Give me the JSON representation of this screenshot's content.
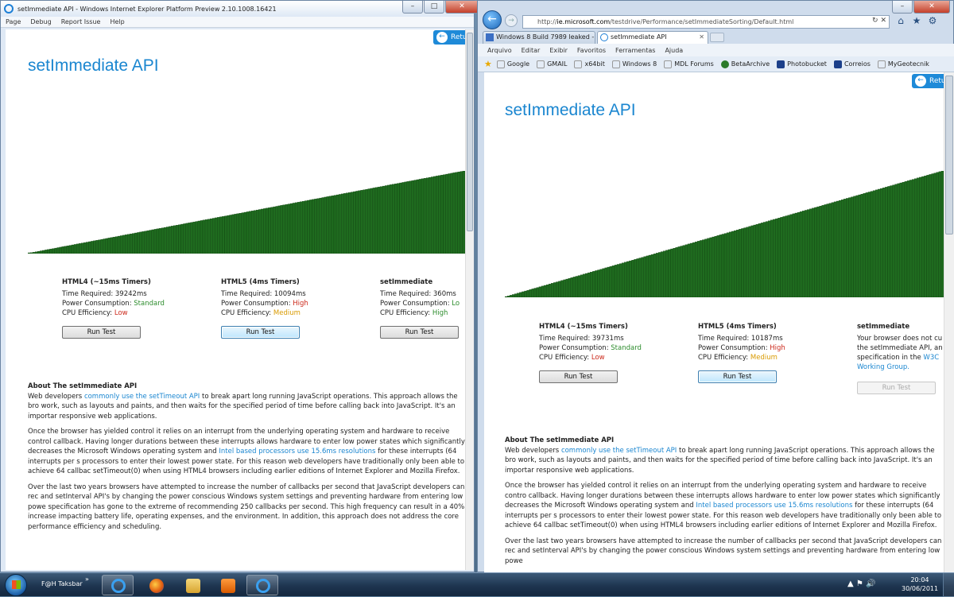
{
  "left_window": {
    "title": "setImmediate API - Windows Internet Explorer Platform Preview 2.10.1008.16421",
    "menu": [
      "Page",
      "Debug",
      "Report Issue",
      "Help"
    ],
    "return_label": "Retu",
    "page_title": "setImmediate API",
    "tests": [
      {
        "heading": "HTML4 (~15ms Timers)",
        "time": "Time Required: 39242ms",
        "power_label": "Power Consumption:",
        "power": "Standard",
        "cpu_label": "CPU Efficiency:",
        "cpu": "Low",
        "button": "Run Test"
      },
      {
        "heading": "HTML5 (4ms Timers)",
        "time": "Time Required: 10094ms",
        "power_label": "Power Consumption:",
        "power": "High",
        "cpu_label": "CPU Efficiency:",
        "cpu": "Medium",
        "button": "Run Test"
      },
      {
        "heading": "setImmediate",
        "time": "Time Required: 360ms",
        "power_label": "Power Consumption:",
        "power": "Lo",
        "cpu_label": "CPU Efficiency:",
        "cpu": "High",
        "button": "Run Test"
      }
    ],
    "about": {
      "heading": "About The setImmediate API",
      "p1_a": "Web developers ",
      "p1_link": "commonly use the setTimeout API",
      "p1_b": " to break apart long running JavaScript operations. This approach allows the bro work, such as layouts and paints, and then waits for the specified period of time before calling back into JavaScript. It's an importar responsive web applications.",
      "p2_a": "Once the browser has yielded control it relies on an interrupt from the underlying operating system and hardware to receive control callback. Having longer durations between these interrupts allows hardware to enter low power states which significantly decreases the Microsoft Windows operating system and ",
      "p2_link": "Intel based processors use 15.6ms resolutions",
      "p2_b": " for these interrupts (64 interrupts per s processors to enter their lowest power state. For this reason web developers have traditionally only been able to achieve 64 callbac setTimeout(0) when using HTML4 browsers including earlier editions of Internet Explorer and Mozilla Firefox.",
      "p3": "Over the last two years browsers have attempted to increase the number of callbacks per second that JavaScript developers can rec and setInterval API's by changing the power conscious Windows system settings and preventing hardware from entering low powe specification has gone to the extreme of recommending 250 callbacks per second. This high frequency can result in a 40% increase impacting battery life, operating expenses, and the environment. In addition, this approach does not address the core performance efficiency and scheduling."
    }
  },
  "right_window": {
    "url_prefix": "http://",
    "url_host": "ie.microsoft.com",
    "url_path": "/testdrive/Performance/setImmediateSorting/Default.html",
    "tabs": [
      {
        "label": "Windows 8 Build 7989 leaked - ..."
      },
      {
        "label": "setImmediate API"
      }
    ],
    "menu": [
      "Arquivo",
      "Editar",
      "Exibir",
      "Favoritos",
      "Ferramentas",
      "Ajuda"
    ],
    "favorites": [
      {
        "label": "Google",
        "color": "#ffffff"
      },
      {
        "label": "GMAIL",
        "color": "#ffffff"
      },
      {
        "label": "x64bit",
        "color": "#ffffff"
      },
      {
        "label": "Windows 8",
        "color": "#ffffff"
      },
      {
        "label": "MDL Forums",
        "color": "#ffffff"
      },
      {
        "label": "BetaArchive",
        "color": "#2a7a2a"
      },
      {
        "label": "Photobucket",
        "color": "#1b3f8a"
      },
      {
        "label": "Correios",
        "color": "#1b3f8a"
      },
      {
        "label": "MyGeotecnik",
        "color": "#ffffff"
      }
    ],
    "return_label": "Retu",
    "page_title": "setImmediate API",
    "tests": [
      {
        "heading": "HTML4 (~15ms Timers)",
        "time": "Time Required: 39731ms",
        "power_label": "Power Consumption:",
        "power": "Standard",
        "cpu_label": "CPU Efficiency:",
        "cpu": "Low",
        "button": "Run Test"
      },
      {
        "heading": "HTML5 (4ms Timers)",
        "time": "Time Required: 10187ms",
        "power_label": "Power Consumption:",
        "power": "High",
        "cpu_label": "CPU Efficiency:",
        "cpu": "Medium",
        "button": "Run Test"
      }
    ],
    "immediate": {
      "heading": "setImmediate",
      "line1": "Your browser does not cu",
      "line2": "the setImmediate API, an",
      "line3_a": "specification in the ",
      "line3_link": "W3C",
      "line4_link": "Working Group.",
      "button": "Run Test"
    },
    "about": {
      "heading": "About The setImmediate API",
      "p1_a": "Web developers ",
      "p1_link": "commonly use the setTimeout API",
      "p1_b": " to break apart long running JavaScript operations. This approach allows the bro work, such as layouts and paints, and then waits for the specified period of time before calling back into JavaScript. It's an importar responsive web applications.",
      "p2_a": "Once the browser has yielded control it relies on an interrupt from the underlying operating system and hardware to receive contro callback. Having longer durations between these interrupts allows hardware to enter low power states which significantly decreases the Microsoft Windows operating system and ",
      "p2_link": "Intel based processors use 15.6ms resolutions",
      "p2_b": " for these interrupts (64 interrupts per s processors to enter their lowest power state. For this reason web developers have traditionally only been able to achieve 64 callbac setTimeout(0) when using HTML4 browsers including earlier editions of Internet Explorer and Mozilla Firefox.",
      "p3": "Over the last two years browsers have attempted to increase the number of callbacks per second that JavaScript developers can rec and setInterval API's by changing the power conscious Windows system settings and preventing hardware from entering low powe"
    }
  },
  "chart_data": {
    "type": "bar",
    "bar_color": "#1f6b1f",
    "bar_outline": "#0a3a0a",
    "note": "ascending sorted bars"
  },
  "taskbar": {
    "label": "F@H Taksbar",
    "chevron": "»",
    "time": "20:04",
    "date": "30/06/2011",
    "apps": [
      "ie-icon",
      "firefox-icon",
      "explorer-icon",
      "media-player-icon",
      "ie-icon"
    ]
  }
}
